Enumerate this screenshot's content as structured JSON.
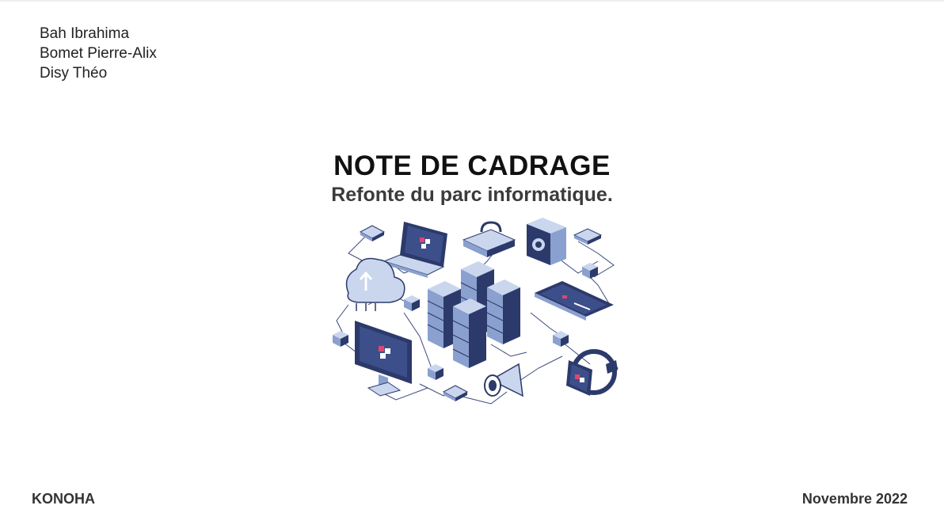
{
  "authors": [
    "Bah Ibrahima",
    "Bomet Pierre-Alix",
    "Disy Théo"
  ],
  "title": "NOTE DE CADRAGE",
  "subtitle": "Refonte du parc informatique.",
  "footer": {
    "company": "KONOHA",
    "date": "Novembre 2022"
  },
  "illustration": {
    "icons": [
      "laptop-icon",
      "padlock-icon",
      "camera-icon",
      "cloud-icon",
      "server-rack-icon",
      "smartphone-icon",
      "monitor-icon",
      "megaphone-icon",
      "smartwatch-icon",
      "chip-icon"
    ],
    "colors": {
      "navy": "#2c3a6b",
      "light_blue": "#c9d6ee",
      "mid_blue": "#8aa0cf",
      "accent_pink": "#e0466d",
      "line": "#3a4a7a"
    }
  }
}
